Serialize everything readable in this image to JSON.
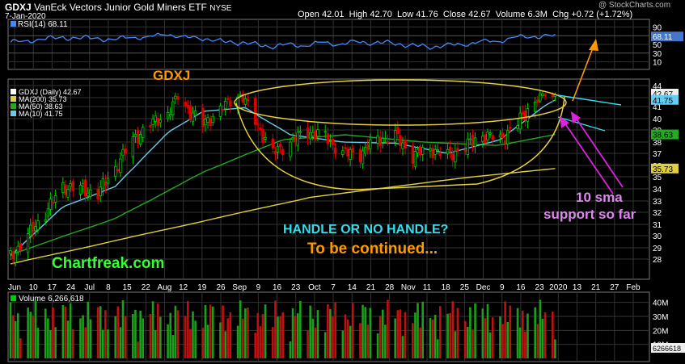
{
  "header": {
    "symbol": "GDXJ",
    "name": "VanEck Vectors Junior Gold Miners ETF",
    "exchange": "NYSE",
    "date": "7-Jan-2020",
    "open_label": "Open",
    "open": "42.01",
    "high_label": "High",
    "high": "42.70",
    "low_label": "Low",
    "low": "41.76",
    "close_label": "Close",
    "close": "42.67",
    "volume_label": "Volume",
    "volume": "6.3M",
    "chg_label": "Chg",
    "chg": "+0.72 (+1.72%)",
    "watermark": "@ StockCharts.com"
  },
  "annotations": {
    "ticker": "GDXJ",
    "question": "HANDLE OR NO HANDLE?",
    "continued": "To be continued...",
    "brand": "Chartfreak.com",
    "sma_line1": "10 sma",
    "sma_line2": "support so far"
  },
  "colors": {
    "up": "#00cc00",
    "down": "#dd0000",
    "ma200": "#e0d040",
    "ma50": "#22aa22",
    "ma10": "#66ccee",
    "rsi": "#4488ff",
    "cup": "#e8d040",
    "orange": "#ff9900",
    "cyan": "#33ddee",
    "magenta": "#dd22dd",
    "lavender": "#dd88ee",
    "brand": "#33ff33"
  },
  "chart_data": [
    {
      "type": "line",
      "panel": "rsi",
      "legend": "RSI(14) 68.11",
      "ylim": [
        0,
        100
      ],
      "y_ticks": [
        90,
        70,
        50,
        30,
        10
      ],
      "last_value_label": "68.11",
      "last_value": 68.11,
      "x": [
        "2019-06-03",
        "2019-06-24",
        "2019-07-15",
        "2019-08-05",
        "2019-08-26",
        "2019-09-16",
        "2019-10-07",
        "2019-10-28",
        "2019-11-18",
        "2019-12-09",
        "2019-12-30",
        "2020-01-07"
      ],
      "series": [
        {
          "values": [
            55,
            66,
            62,
            72,
            58,
            46,
            52,
            55,
            44,
            55,
            70,
            68.11
          ]
        }
      ]
    },
    {
      "type": "candlestick",
      "panel": "price",
      "legend": [
        "GDXJ (Daily) 42.67",
        "MA(200) 35.73",
        "MA(50) 38.63",
        "MA(10) 41.75"
      ],
      "ylim": [
        27,
        44
      ],
      "y_ticks": [
        44,
        42,
        41,
        40,
        39,
        38,
        37,
        36,
        35,
        34,
        33,
        32,
        31,
        30,
        29,
        28
      ],
      "grid": true,
      "x_tick_labels": [
        "Jun",
        "10",
        "17",
        "24",
        "Jul",
        "8",
        "15",
        "22",
        "Aug",
        "12",
        "19",
        "26",
        "Sep",
        "9",
        "16",
        "23",
        "Oct",
        "7",
        "14",
        "21",
        "28",
        "Nov",
        "11",
        "18",
        "25",
        "Dec",
        "9",
        "16",
        "23",
        "2020",
        "13",
        "21",
        "27",
        "Feb"
      ],
      "price_tags": [
        {
          "label": "42.67",
          "value": 42.67,
          "series": "close"
        },
        {
          "label": "41.75",
          "value": 41.75,
          "series": "MA(10)"
        },
        {
          "label": "38.63",
          "value": 38.63,
          "series": "MA(50)"
        },
        {
          "label": "35.73",
          "value": 35.73,
          "series": "MA(200)"
        }
      ],
      "close_anchors": [
        [
          "2019-06-03",
          28.2
        ],
        [
          "2019-06-10",
          30.0
        ],
        [
          "2019-06-17",
          32.0
        ],
        [
          "2019-06-24",
          34.2
        ],
        [
          "2019-07-01",
          34.0
        ],
        [
          "2019-07-08",
          33.6
        ],
        [
          "2019-07-15",
          35.8
        ],
        [
          "2019-07-22",
          38.2
        ],
        [
          "2019-07-29",
          39.5
        ],
        [
          "2019-08-05",
          40.4
        ],
        [
          "2019-08-09",
          42.1
        ],
        [
          "2019-08-12",
          41.0
        ],
        [
          "2019-08-19",
          39.5
        ],
        [
          "2019-08-26",
          40.8
        ],
        [
          "2019-09-03",
          42.4
        ],
        [
          "2019-09-09",
          39.8
        ],
        [
          "2019-09-16",
          37.0
        ],
        [
          "2019-09-23",
          38.0
        ],
        [
          "2019-09-30",
          38.9
        ],
        [
          "2019-10-07",
          38.4
        ],
        [
          "2019-10-14",
          37.0
        ],
        [
          "2019-10-21",
          37.0
        ],
        [
          "2019-10-28",
          38.2
        ],
        [
          "2019-11-04",
          38.5
        ],
        [
          "2019-11-11",
          36.8
        ],
        [
          "2019-11-18",
          37.4
        ],
        [
          "2019-11-25",
          36.8
        ],
        [
          "2019-12-02",
          37.6
        ],
        [
          "2019-12-09",
          38.6
        ],
        [
          "2019-12-16",
          38.2
        ],
        [
          "2019-12-23",
          39.6
        ],
        [
          "2019-12-30",
          41.6
        ],
        [
          "2020-01-03",
          42.6
        ],
        [
          "2020-01-06",
          41.95
        ],
        [
          "2020-01-07",
          42.67
        ]
      ],
      "series": [
        {
          "name": "MA(200)",
          "values_at": [
            [
              "2019-06-03",
              27.6
            ],
            [
              "2019-08-01",
              30.4
            ],
            [
              "2019-10-01",
              33.3
            ],
            [
              "2019-12-01",
              34.9
            ],
            [
              "2020-01-07",
              35.73
            ]
          ]
        },
        {
          "name": "MA(50)",
          "values_at": [
            [
              "2019-06-03",
              28.4
            ],
            [
              "2019-07-15",
              31.5
            ],
            [
              "2019-08-20",
              35.5
            ],
            [
              "2019-09-20",
              38.2
            ],
            [
              "2019-10-15",
              38.6
            ],
            [
              "2019-11-15",
              38.0
            ],
            [
              "2019-12-15",
              37.7
            ],
            [
              "2020-01-07",
              38.63
            ]
          ]
        },
        {
          "name": "MA(10)",
          "values_at": [
            [
              "2019-06-03",
              28.3
            ],
            [
              "2019-06-24",
              32.5
            ],
            [
              "2019-07-15",
              34.2
            ],
            [
              "2019-08-05",
              38.8
            ],
            [
              "2019-08-19",
              40.6
            ],
            [
              "2019-09-05",
              40.9
            ],
            [
              "2019-09-23",
              38.6
            ],
            [
              "2019-10-14",
              38.0
            ],
            [
              "2019-11-04",
              37.9
            ],
            [
              "2019-11-25",
              37.0
            ],
            [
              "2019-12-16",
              38.2
            ],
            [
              "2020-01-07",
              41.75
            ]
          ]
        }
      ]
    },
    {
      "type": "bar",
      "panel": "volume",
      "legend": "Volume 6,266,618",
      "y_ticks_label": [
        "40M",
        "30M",
        "20M",
        "10M"
      ],
      "y_ticks": [
        40,
        30,
        20,
        10
      ],
      "unit": "M",
      "last_value_label": "6266618",
      "last_value": 6266618,
      "series": [
        {
          "values_millions_range": [
            5,
            45
          ],
          "last": 6.27
        }
      ]
    }
  ]
}
